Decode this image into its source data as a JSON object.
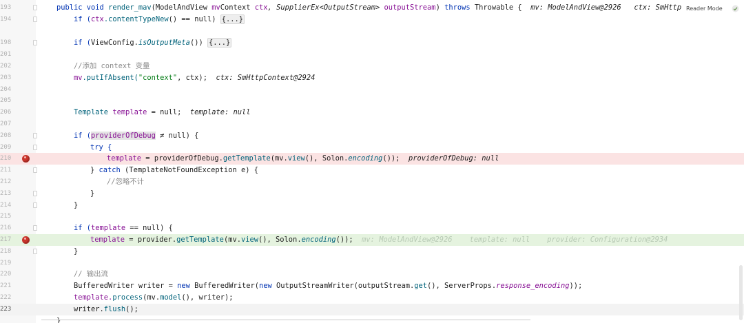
{
  "editor": {
    "reader_mode": "Reader Mode",
    "lines": [
      {
        "n": "193"
      },
      {
        "n": "194"
      },
      {
        "n": "198"
      },
      {
        "n": "201"
      },
      {
        "n": "202"
      },
      {
        "n": "203"
      },
      {
        "n": "204"
      },
      {
        "n": "205"
      },
      {
        "n": "206"
      },
      {
        "n": "207"
      },
      {
        "n": "208"
      },
      {
        "n": "209"
      },
      {
        "n": "210"
      },
      {
        "n": "211"
      },
      {
        "n": "212"
      },
      {
        "n": "213"
      },
      {
        "n": "214"
      },
      {
        "n": "215"
      },
      {
        "n": "216"
      },
      {
        "n": "217"
      },
      {
        "n": "218"
      },
      {
        "n": "219"
      },
      {
        "n": "220"
      },
      {
        "n": "221"
      },
      {
        "n": "222"
      },
      {
        "n": "223"
      }
    ],
    "code": {
      "l193": {
        "kw1": "public void ",
        "name": "render_mav",
        "p1t": "(ModelAndView ",
        "p1": "mv",
        ", ": ", ",
        "p2t": "Context ",
        "p2": "ctx",
        "p3t": ", SupplierEx<OutputStream> ",
        "p3": "outputStream",
        ") ": ") ",
        "throws": "throws ",
        "exc": "Throwable {",
        "hint1": "mv: ModelAndView@2926",
        "hint2": "ctx: SmHttp"
      },
      "l194": {
        "if": "if (",
        "obj": "ctx",
        "call": ".contentTypeNew",
        "rest": "() == null) ",
        "fold": "{...}"
      },
      "l198": {
        "if": "if (",
        "cls": "ViewConfig.",
        "call": "isOutputMeta",
        "rest": "()) ",
        "fold": "{...}"
      },
      "l202": {
        "cmt": "//添加 context 变量"
      },
      "l203": {
        "obj": "mv",
        "call": ".putIfAbsent(",
        "str": "\"context\"",
        "rest": ", ctx);",
        "hint": "ctx: SmHttpContext@2924"
      },
      "l206": {
        "type": "Template ",
        "var": "template",
        "rest": " = null;",
        "hint": "template: null"
      },
      "l208": {
        "if": "if (",
        "var": "providerOfDebug",
        "rest": " ≠ null) {"
      },
      "l209": {
        "kw": "try {"
      },
      "l210": {
        "var": "template",
        "a": " = providerOfDebug.",
        "call": "getTemplate",
        "b": "(mv.",
        "call2": "view",
        "c": "(), Solon.",
        "call3": "encoding",
        "d": "());",
        "hint": "providerOfDebug: null"
      },
      "l211": {
        "a": "} ",
        "kw": "catch",
        "b": " (TemplateNotFoundException e) {"
      },
      "l212": {
        "cmt": "//忽略不计"
      },
      "l213": {
        "t": "}"
      },
      "l214": {
        "t": "}"
      },
      "l216": {
        "if": "if (",
        "var": "template",
        "rest": " == null) {"
      },
      "l217": {
        "var": "template",
        "a": " = provider.",
        "call": "getTemplate",
        "b": "(mv.",
        "call2": "view",
        "c": "(), Solon.",
        "call3": "encoding",
        "d": "());",
        "h1": "mv: ModelAndView@2926",
        "h2": "template: null",
        "h3": "provider: Configuration@2934"
      },
      "l218": {
        "t": "}"
      },
      "l220": {
        "cmt": "// 输出流"
      },
      "l221": {
        "a": "BufferedWriter writer = ",
        "kw": "new ",
        "b": "BufferedWriter(",
        "kw2": "new ",
        "c": "OutputStreamWriter(outputStream.",
        "call": "get",
        "d": "(), ServerProps.",
        "fld": "response_encoding",
        "e": "));"
      },
      "l222": {
        "a": "template.",
        "call": "process",
        "b": "(mv.",
        "call2": "model",
        "c": "(), writer);"
      },
      "l223": {
        "a": "writer.",
        "call": "flush",
        "b": "();"
      },
      "l224": {
        "t": "}"
      }
    },
    "colors": {
      "breakpoint": "#c9342b",
      "error_line": "#fbe3e3",
      "exec_line": "#e5f3df",
      "keyword": "#0033b3"
    }
  }
}
